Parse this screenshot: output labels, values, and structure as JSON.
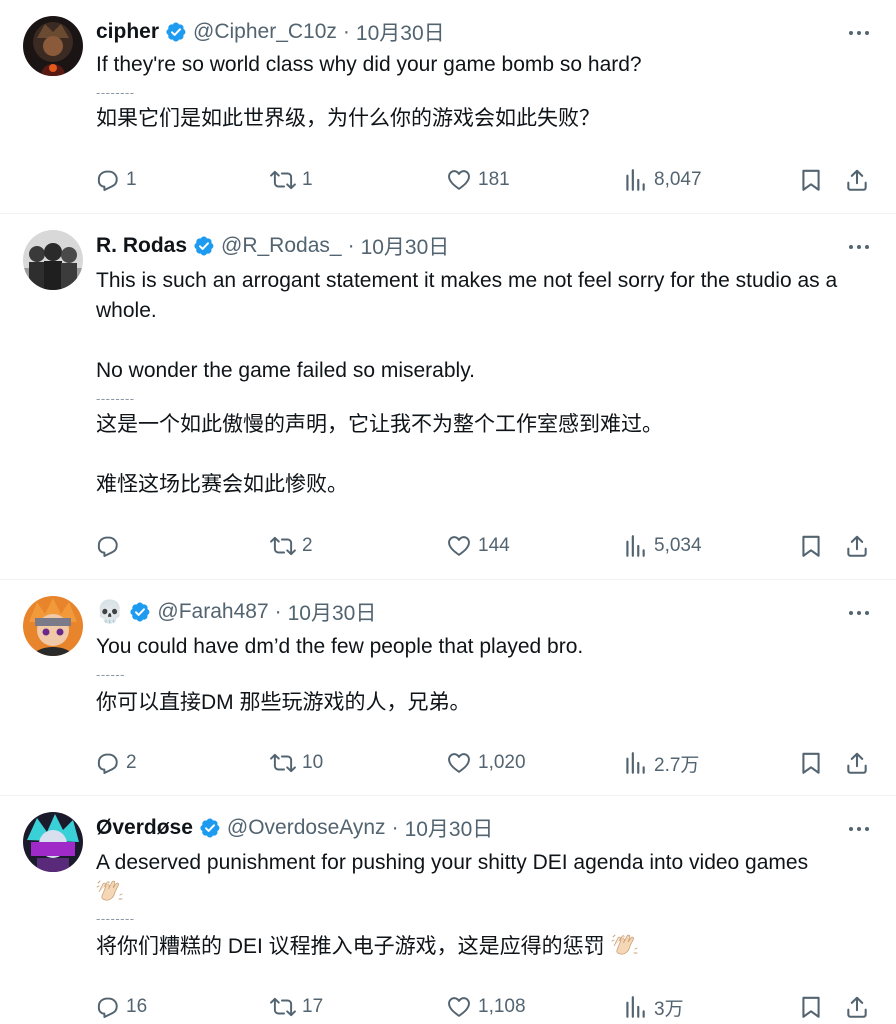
{
  "tweets": [
    {
      "name": "cipher",
      "verified": true,
      "handle": "@Cipher_C10z",
      "sep": "·",
      "date": "10月30日",
      "text": [
        "If they're so world class why did your game bomb so hard?"
      ],
      "divider": "--------",
      "translation": [
        "如果它们是如此世界级，为什么你的游戏会如此失败？"
      ],
      "replies": "1",
      "reposts": "1",
      "likes": "181",
      "views": "8,047"
    },
    {
      "name": "R. Rodas",
      "verified": true,
      "handle": "@R_Rodas_",
      "sep": "·",
      "date": "10月30日",
      "text": [
        "This is such an arrogant statement it makes me not feel sorry for the studio as a whole.",
        "No wonder the game failed so miserably."
      ],
      "divider": "--------",
      "translation": [
        "这是一个如此傲慢的声明，它让我不为整个工作室感到难过。",
        "难怪这场比赛会如此惨败。"
      ],
      "replies": "",
      "reposts": "2",
      "likes": "144",
      "views": "5,034"
    },
    {
      "name": "💀",
      "verified": true,
      "handle": "@Farah487",
      "sep": "·",
      "date": "10月30日",
      "text": [
        "You could have dm’d the few people that played bro."
      ],
      "divider": "------",
      "translation": [
        "你可以直接DM 那些玩游戏的人，兄弟。"
      ],
      "replies": "2",
      "reposts": "10",
      "likes": "1,020",
      "views": "2.7万"
    },
    {
      "name": "Øverdøse",
      "verified": true,
      "handle": "@OverdoseAynz",
      "sep": "·",
      "date": "10月30日",
      "text": [
        "A deserved punishment for pushing your shitty DEI agenda into video games"
      ],
      "divider": "--------",
      "translation": [
        "将你们糟糕的 DEI 议程推入电子游戏，这是应得的惩罚"
      ],
      "replies": "16",
      "reposts": "17",
      "likes": "1,108",
      "views": "3万"
    }
  ],
  "icons": {
    "reply": "reply-icon",
    "repost": "repost-icon",
    "like": "heart-icon",
    "views": "analytics-icon",
    "bookmark": "bookmark-icon",
    "share": "share-icon",
    "verified": "verified-badge-icon",
    "more": "more-icon",
    "clap": "clapping-hands-emoji"
  },
  "colors": {
    "verified": "#1d9bf0",
    "secondary_text": "#536471",
    "text": "#0f1419"
  }
}
